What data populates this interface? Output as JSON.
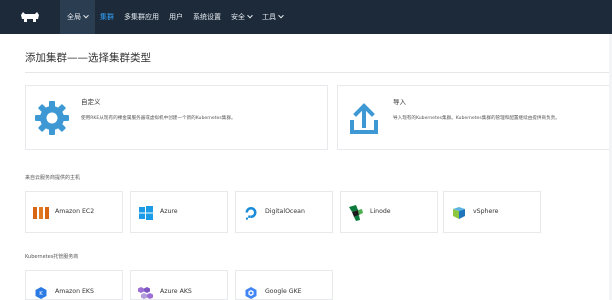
{
  "nav": {
    "items": [
      {
        "label": "全局",
        "has_chevron": true
      },
      {
        "label": "集群",
        "active": true
      },
      {
        "label": "多集群应用"
      },
      {
        "label": "用户"
      },
      {
        "label": "系统设置"
      },
      {
        "label": "安全",
        "has_chevron": true
      },
      {
        "label": "工具",
        "has_chevron": true
      }
    ]
  },
  "page": {
    "title": "添加集群——选择集群类型"
  },
  "options": [
    {
      "title": "自定义",
      "desc": "使用RKE从现有的裸金属服务器或虚拟机中创建一个新的Kubernetes集群。",
      "icon": "gear-icon"
    },
    {
      "title": "导入",
      "desc": "导入现有的Kubernetes集群。Kubernetes集群的管理和配置继续由提供商负责。",
      "icon": "upload-icon"
    }
  ],
  "sections": {
    "hosted_label": "来自云服务商提供的主机",
    "k8s_label": "Kubernetes托管服务商"
  },
  "hosts": [
    {
      "name": "Amazon EC2",
      "icon": "amazon-ec2-icon"
    },
    {
      "name": "Azure",
      "icon": "azure-icon"
    },
    {
      "name": "DigitalOcean",
      "icon": "digitalocean-icon"
    },
    {
      "name": "Linode",
      "icon": "linode-icon"
    },
    {
      "name": "vSphere",
      "icon": "vsphere-icon"
    }
  ],
  "managed": [
    {
      "name": "Amazon EKS",
      "icon": "amazon-eks-icon"
    },
    {
      "name": "Azure AKS",
      "icon": "azure-aks-icon"
    },
    {
      "name": "Google GKE",
      "icon": "google-gke-icon"
    }
  ],
  "colors": {
    "topbar": "#1c2a39",
    "accent": "#3d98d3",
    "active_nav": "#33a6ff"
  }
}
